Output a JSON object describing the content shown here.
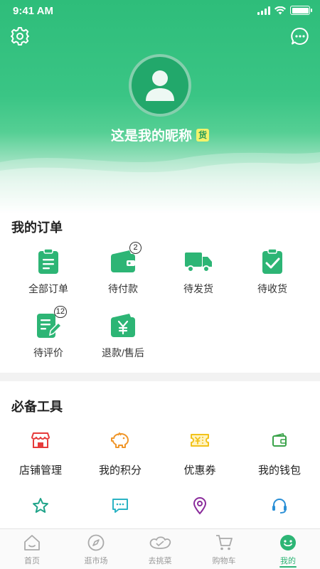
{
  "status_bar": {
    "time": "9:41 AM"
  },
  "profile": {
    "nickname": "这是我的昵称",
    "badge": "货"
  },
  "orders": {
    "title": "我的订单",
    "items": [
      {
        "label": "全部订单",
        "icon": "clipboard-list-icon"
      },
      {
        "label": "待付款",
        "icon": "wallet-icon",
        "count": "2"
      },
      {
        "label": "待发货",
        "icon": "truck-icon"
      },
      {
        "label": "待收货",
        "icon": "clipboard-check-icon"
      },
      {
        "label": "待评价",
        "icon": "edit-document-icon",
        "count": "12"
      },
      {
        "label": "退款/售后",
        "icon": "refund-yen-icon"
      }
    ]
  },
  "tools": {
    "title": "必备工具",
    "items": [
      {
        "label": "店铺管理",
        "icon": "store-icon"
      },
      {
        "label": "我的积分",
        "icon": "piggy-bank-icon"
      },
      {
        "label": "优惠券",
        "icon": "coupon-icon"
      },
      {
        "label": "我的钱包",
        "icon": "wallet-outline-icon"
      },
      {
        "icon": "star-icon"
      },
      {
        "icon": "message-icon"
      },
      {
        "icon": "location-pin-icon"
      },
      {
        "icon": "headset-icon"
      }
    ]
  },
  "tabbar": {
    "items": [
      {
        "label": "首页",
        "icon": "home-icon"
      },
      {
        "label": "逛市场",
        "icon": "compass-icon"
      },
      {
        "label": "去挑菜",
        "icon": "vegetable-icon"
      },
      {
        "label": "购物车",
        "icon": "cart-icon"
      },
      {
        "label": "我的",
        "icon": "smiley-icon",
        "active": true
      }
    ]
  },
  "colors": {
    "primary": "#2db575",
    "header_top": "#2ebd7a",
    "tool_red": "#e63b3b",
    "tool_orange": "#f0962a",
    "tool_yellow": "#f2c21b",
    "tool_green": "#3aa34a",
    "tool_teal": "#1fa389",
    "tool_cyan": "#2bb3c4",
    "tool_purple": "#8a2b9b",
    "tool_blue": "#2a8fd6"
  }
}
